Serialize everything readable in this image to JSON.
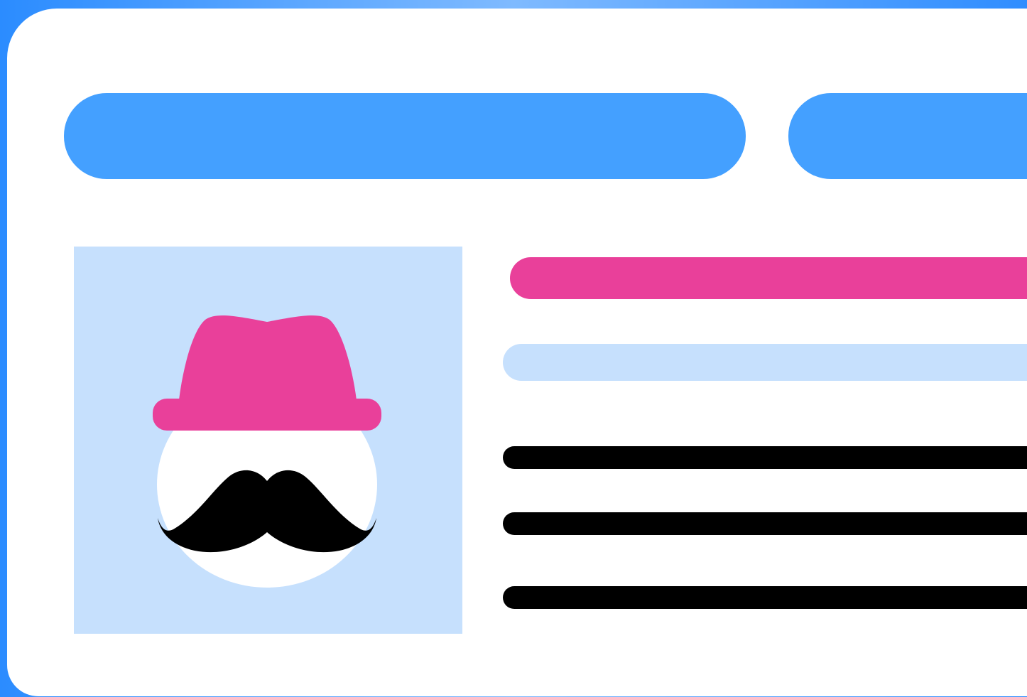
{
  "illustration": {
    "kind": "id-card",
    "avatar": "incognito-avatar-icon",
    "colors": {
      "background_blue": "#2b8cff",
      "card_white": "#ffffff",
      "header_blue": "#44a0ff",
      "accent_pink": "#e9409a",
      "light_blue": "#c6e0fd",
      "text_black": "#000000"
    },
    "placeholder_text_lines": 3
  }
}
